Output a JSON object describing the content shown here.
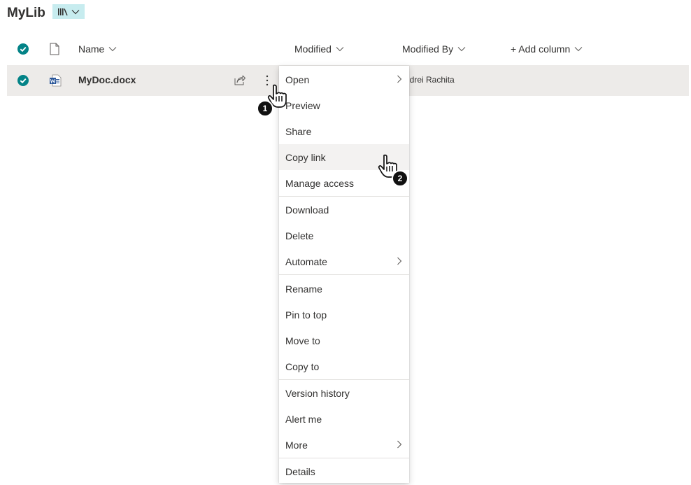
{
  "library": {
    "title": "MyLib"
  },
  "columns": {
    "name": "Name",
    "modified": "Modified",
    "modified_by": "Modified By",
    "add_column": "+ Add column"
  },
  "row": {
    "name": "MyDoc.docx",
    "modified_by": "ndrei Rachita"
  },
  "menu": {
    "items": [
      {
        "label": "Open"
      },
      {
        "label": "Preview"
      },
      {
        "label": "Share"
      },
      {
        "label": "Copy link"
      },
      {
        "label": "Manage access"
      },
      {
        "label": "Download"
      },
      {
        "label": "Delete"
      },
      {
        "label": "Automate"
      },
      {
        "label": "Rename"
      },
      {
        "label": "Pin to top"
      },
      {
        "label": "Move to"
      },
      {
        "label": "Copy to"
      },
      {
        "label": "Version history"
      },
      {
        "label": "Alert me"
      },
      {
        "label": "More"
      },
      {
        "label": "Details"
      }
    ]
  },
  "annotations": {
    "step1": "1",
    "step2": "2"
  },
  "colors": {
    "accent": "#038387",
    "row_selected": "#edebe9",
    "menu_hover": "#f3f2f1",
    "word_blue": "#2b579a",
    "view_switch_bg": "#c7ecef"
  }
}
